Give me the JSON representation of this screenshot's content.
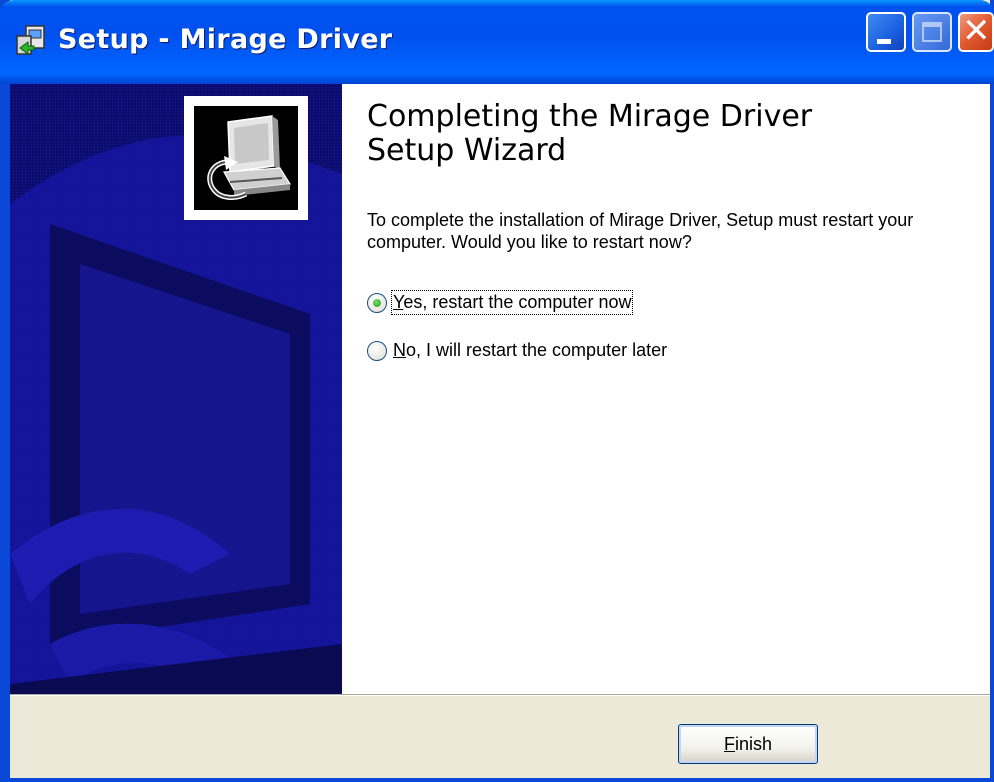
{
  "window": {
    "title": "Setup - Mirage Driver",
    "titlebar_color": "#0053ee",
    "controls": [
      "minimize-icon",
      "maximize-icon",
      "close-icon"
    ]
  },
  "sidebar": {
    "background_color": "#0c0c6e",
    "icon": "computer-install-icon"
  },
  "content": {
    "heading_line1": "Completing the Mirage Driver",
    "heading_line2": "Setup Wizard",
    "description": "To complete the installation of Mirage Driver, Setup must restart your computer. Would you like to restart now?",
    "options": [
      {
        "mnemonic": "Y",
        "rest": "es, restart the computer now",
        "checked": true
      },
      {
        "mnemonic": "N",
        "rest": "o, I will restart the computer later",
        "checked": false
      }
    ]
  },
  "footer": {
    "finish_mnemonic": "F",
    "finish_rest": "inish"
  }
}
